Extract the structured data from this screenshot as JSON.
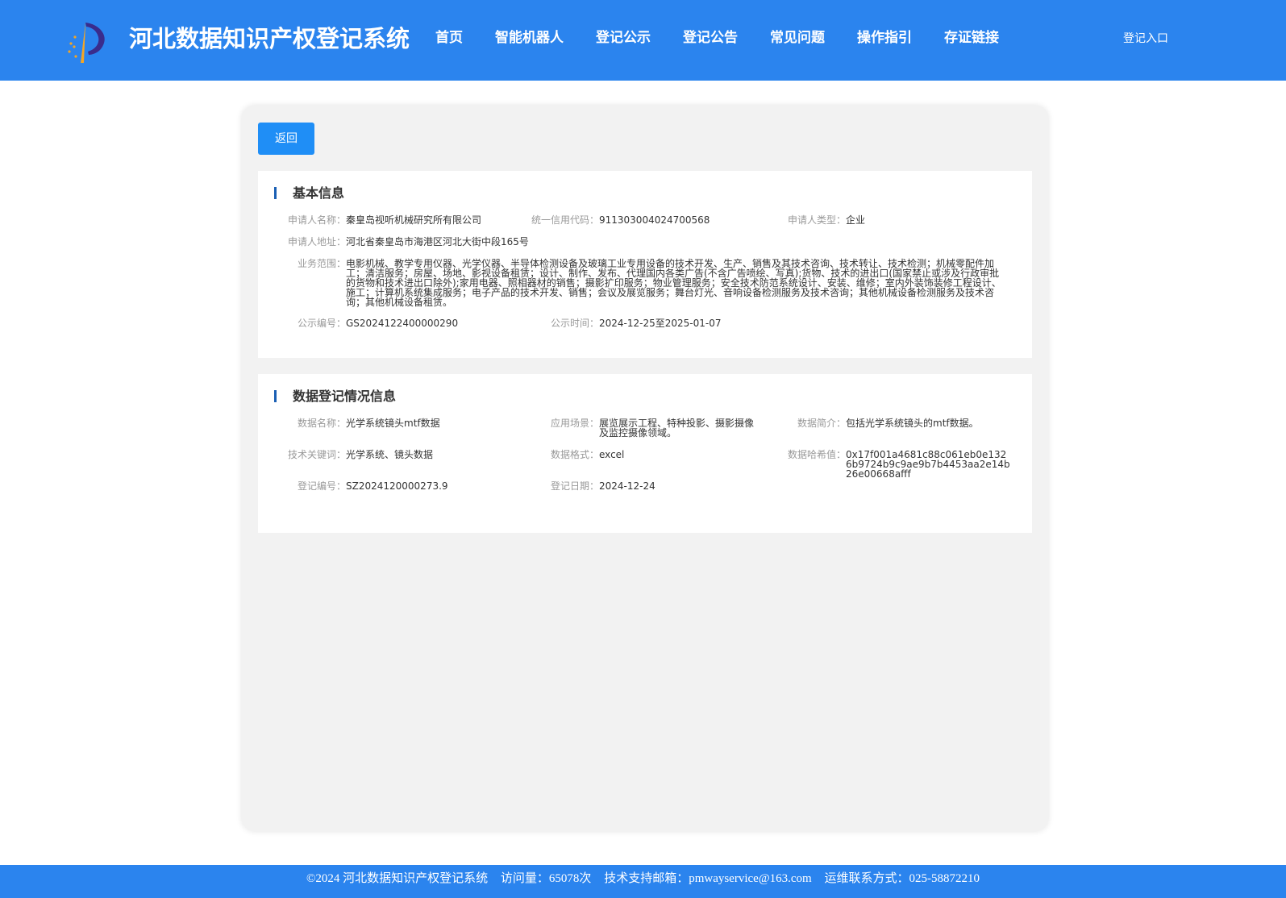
{
  "header": {
    "site_title": "河北数据知识产权登记系统",
    "nav": [
      "首页",
      "智能机器人",
      "登记公示",
      "登记公告",
      "常见问题",
      "操作指引",
      "存证链接"
    ],
    "login_label": "登记入口"
  },
  "actions": {
    "back_label": "返回"
  },
  "basic_info": {
    "title": "基本信息",
    "applicant_name_label": "申请人名称：",
    "applicant_name": "秦皇岛视听机械研究所有限公司",
    "credit_code_label": "统一信用代码：",
    "credit_code": "911303004024700568",
    "applicant_type_label": "申请人类型：",
    "applicant_type": "企业",
    "address_label": "申请人地址：",
    "address": "河北省秦皇岛市海港区河北大街中段165号",
    "scope_label": "业务范围：",
    "scope": "电影机械、教学专用仪器、光学仪器、半导体检测设备及玻璃工业专用设备的技术开发、生产、销售及其技术咨询、技术转让、技术检测；机械零配件加工；清洁服务；房屋、场地、影视设备租赁；设计、制作、发布、代理国内各类广告(不含广告喷绘、写真);货物、技术的进出口(国家禁止或涉及行政审批的货物和技术进出口除外);家用电器、照相器材的销售；摄影扩印服务；物业管理服务；安全技术防范系统设计、安装、维修；室内外装饰装修工程设计、施工；计算机系统集成服务；电子产品的技术开发、销售；会议及展览服务；舞台灯光、音响设备检测服务及技术咨询；其他机械设备检测服务及技术咨询；其他机械设备租赁。",
    "notice_no_label": "公示编号：",
    "notice_no": "GS2024122400000290",
    "notice_time_label": "公示时间：",
    "notice_time": "2024-12-25至2025-01-07"
  },
  "data_info": {
    "title": "数据登记情况信息",
    "data_name_label": "数据名称：",
    "data_name": "光学系统镜头mtf数据",
    "scenario_label": "应用场景：",
    "scenario": "展览展示工程、特种投影、摄影摄像及监控摄像领域。",
    "summary_label": "数据简介：",
    "summary": "包括光学系统镜头的mtf数据。",
    "keywords_label": "技术关键词：",
    "keywords": "光学系统、镜头数据",
    "format_label": "数据格式：",
    "format": "excel",
    "hash_label": "数据哈希值：",
    "hash": "0x17f001a4681c88c061eb0e1326b9724b9c9ae9b7b4453aa2e14b26e00668afff",
    "reg_no_label": "登记编号：",
    "reg_no": "SZ2024120000273.9",
    "reg_date_label": "登记日期：",
    "reg_date": "2024-12-24"
  },
  "footer": {
    "copyright": "©2024 河北数据知识产权登记系统",
    "visits": "访问量：65078次",
    "email": "技术支持邮箱：pmwayservice@163.com",
    "phone": "运维联系方式：025-58872210"
  },
  "colors": {
    "brand": "#2b84ee",
    "button": "#1f8ef6",
    "title_bar": "#1a5fb4"
  },
  "icons": {
    "logo": "logo-icon"
  }
}
